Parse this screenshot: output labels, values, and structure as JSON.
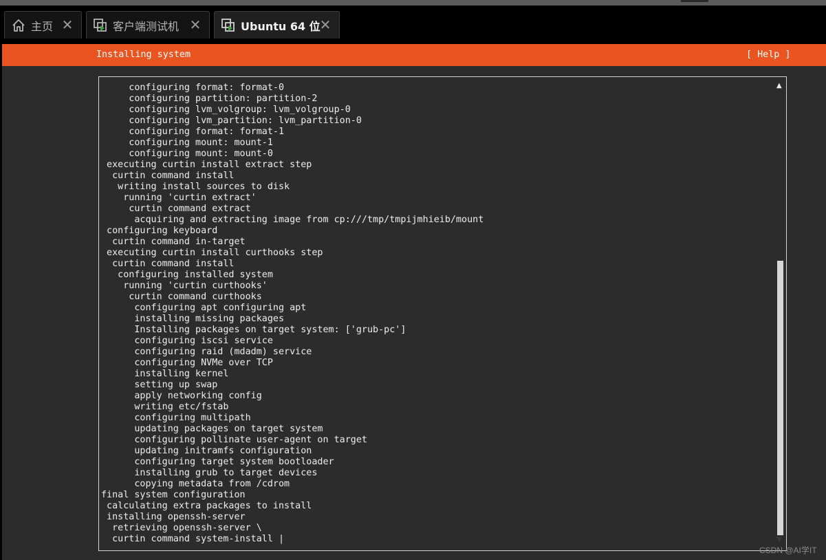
{
  "tabs": [
    {
      "label": "主页",
      "icon": "home-icon",
      "active": false
    },
    {
      "label": "客户端测试机",
      "icon": "vm-icon",
      "active": false
    },
    {
      "label": "Ubuntu 64 位",
      "icon": "vm-running-icon",
      "active": true
    }
  ],
  "installer": {
    "title": "Installing system",
    "help": "[ Help ]",
    "accent_color": "#e95420",
    "log_lines": [
      "     configuring format: format-0",
      "     configuring partition: partition-2",
      "     configuring lvm_volgroup: lvm_volgroup-0",
      "     configuring lvm_partition: lvm_partition-0",
      "     configuring format: format-1",
      "     configuring mount: mount-1",
      "     configuring mount: mount-0",
      " executing curtin install extract step",
      "  curtin command install",
      "   writing install sources to disk",
      "    running 'curtin extract'",
      "     curtin command extract",
      "      acquiring and extracting image from cp:///tmp/tmpijmhieib/mount",
      " configuring keyboard",
      "  curtin command in-target",
      " executing curtin install curthooks step",
      "  curtin command install",
      "   configuring installed system",
      "    running 'curtin curthooks'",
      "     curtin command curthooks",
      "      configuring apt configuring apt",
      "      installing missing packages",
      "      Installing packages on target system: ['grub-pc']",
      "      configuring iscsi service",
      "      configuring raid (mdadm) service",
      "      configuring NVMe over TCP",
      "      installing kernel",
      "      setting up swap",
      "      apply networking config",
      "      writing etc/fstab",
      "      configuring multipath",
      "      updating packages on target system",
      "      configuring pollinate user-agent on target",
      "      updating initramfs configuration",
      "      configuring target system bootloader",
      "      installing grub to target devices",
      "      copying metadata from /cdrom",
      "final system configuration",
      " calculating extra packages to install",
      " installing openssh-server",
      "  retrieving openssh-server \\",
      "  curtin command system-install |"
    ],
    "scroll_position": {
      "visible_fraction": 0.62,
      "offset_fraction": 0.38
    }
  },
  "watermark": "CSDN @AI学IT"
}
